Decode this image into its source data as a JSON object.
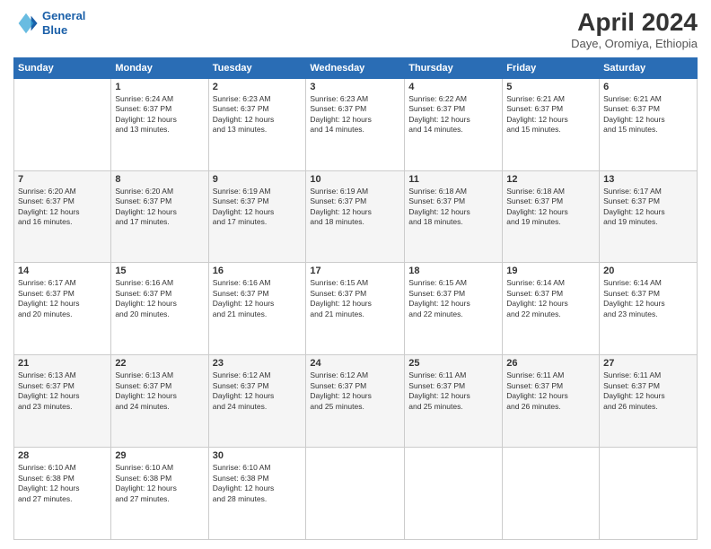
{
  "logo": {
    "line1": "General",
    "line2": "Blue"
  },
  "title": "April 2024",
  "subtitle": "Daye, Oromiya, Ethiopia",
  "days_of_week": [
    "Sunday",
    "Monday",
    "Tuesday",
    "Wednesday",
    "Thursday",
    "Friday",
    "Saturday"
  ],
  "weeks": [
    [
      {
        "day": "",
        "info": ""
      },
      {
        "day": "1",
        "info": "Sunrise: 6:24 AM\nSunset: 6:37 PM\nDaylight: 12 hours\nand 13 minutes."
      },
      {
        "day": "2",
        "info": "Sunrise: 6:23 AM\nSunset: 6:37 PM\nDaylight: 12 hours\nand 13 minutes."
      },
      {
        "day": "3",
        "info": "Sunrise: 6:23 AM\nSunset: 6:37 PM\nDaylight: 12 hours\nand 14 minutes."
      },
      {
        "day": "4",
        "info": "Sunrise: 6:22 AM\nSunset: 6:37 PM\nDaylight: 12 hours\nand 14 minutes."
      },
      {
        "day": "5",
        "info": "Sunrise: 6:21 AM\nSunset: 6:37 PM\nDaylight: 12 hours\nand 15 minutes."
      },
      {
        "day": "6",
        "info": "Sunrise: 6:21 AM\nSunset: 6:37 PM\nDaylight: 12 hours\nand 15 minutes."
      }
    ],
    [
      {
        "day": "7",
        "info": "Sunrise: 6:20 AM\nSunset: 6:37 PM\nDaylight: 12 hours\nand 16 minutes."
      },
      {
        "day": "8",
        "info": "Sunrise: 6:20 AM\nSunset: 6:37 PM\nDaylight: 12 hours\nand 17 minutes."
      },
      {
        "day": "9",
        "info": "Sunrise: 6:19 AM\nSunset: 6:37 PM\nDaylight: 12 hours\nand 17 minutes."
      },
      {
        "day": "10",
        "info": "Sunrise: 6:19 AM\nSunset: 6:37 PM\nDaylight: 12 hours\nand 18 minutes."
      },
      {
        "day": "11",
        "info": "Sunrise: 6:18 AM\nSunset: 6:37 PM\nDaylight: 12 hours\nand 18 minutes."
      },
      {
        "day": "12",
        "info": "Sunrise: 6:18 AM\nSunset: 6:37 PM\nDaylight: 12 hours\nand 19 minutes."
      },
      {
        "day": "13",
        "info": "Sunrise: 6:17 AM\nSunset: 6:37 PM\nDaylight: 12 hours\nand 19 minutes."
      }
    ],
    [
      {
        "day": "14",
        "info": "Sunrise: 6:17 AM\nSunset: 6:37 PM\nDaylight: 12 hours\nand 20 minutes."
      },
      {
        "day": "15",
        "info": "Sunrise: 6:16 AM\nSunset: 6:37 PM\nDaylight: 12 hours\nand 20 minutes."
      },
      {
        "day": "16",
        "info": "Sunrise: 6:16 AM\nSunset: 6:37 PM\nDaylight: 12 hours\nand 21 minutes."
      },
      {
        "day": "17",
        "info": "Sunrise: 6:15 AM\nSunset: 6:37 PM\nDaylight: 12 hours\nand 21 minutes."
      },
      {
        "day": "18",
        "info": "Sunrise: 6:15 AM\nSunset: 6:37 PM\nDaylight: 12 hours\nand 22 minutes."
      },
      {
        "day": "19",
        "info": "Sunrise: 6:14 AM\nSunset: 6:37 PM\nDaylight: 12 hours\nand 22 minutes."
      },
      {
        "day": "20",
        "info": "Sunrise: 6:14 AM\nSunset: 6:37 PM\nDaylight: 12 hours\nand 23 minutes."
      }
    ],
    [
      {
        "day": "21",
        "info": "Sunrise: 6:13 AM\nSunset: 6:37 PM\nDaylight: 12 hours\nand 23 minutes."
      },
      {
        "day": "22",
        "info": "Sunrise: 6:13 AM\nSunset: 6:37 PM\nDaylight: 12 hours\nand 24 minutes."
      },
      {
        "day": "23",
        "info": "Sunrise: 6:12 AM\nSunset: 6:37 PM\nDaylight: 12 hours\nand 24 minutes."
      },
      {
        "day": "24",
        "info": "Sunrise: 6:12 AM\nSunset: 6:37 PM\nDaylight: 12 hours\nand 25 minutes."
      },
      {
        "day": "25",
        "info": "Sunrise: 6:11 AM\nSunset: 6:37 PM\nDaylight: 12 hours\nand 25 minutes."
      },
      {
        "day": "26",
        "info": "Sunrise: 6:11 AM\nSunset: 6:37 PM\nDaylight: 12 hours\nand 26 minutes."
      },
      {
        "day": "27",
        "info": "Sunrise: 6:11 AM\nSunset: 6:37 PM\nDaylight: 12 hours\nand 26 minutes."
      }
    ],
    [
      {
        "day": "28",
        "info": "Sunrise: 6:10 AM\nSunset: 6:38 PM\nDaylight: 12 hours\nand 27 minutes."
      },
      {
        "day": "29",
        "info": "Sunrise: 6:10 AM\nSunset: 6:38 PM\nDaylight: 12 hours\nand 27 minutes."
      },
      {
        "day": "30",
        "info": "Sunrise: 6:10 AM\nSunset: 6:38 PM\nDaylight: 12 hours\nand 28 minutes."
      },
      {
        "day": "",
        "info": ""
      },
      {
        "day": "",
        "info": ""
      },
      {
        "day": "",
        "info": ""
      },
      {
        "day": "",
        "info": ""
      }
    ]
  ]
}
